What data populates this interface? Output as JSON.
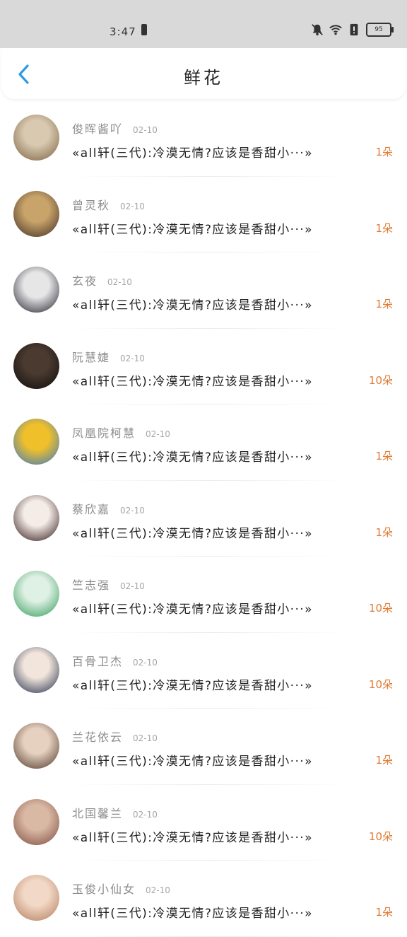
{
  "status": {
    "time": "3:47",
    "battery": "95"
  },
  "header": {
    "title": "鲜花"
  },
  "items": [
    {
      "name": "俊晖酱吖",
      "date": "02-10",
      "message": "«all轩(三代):冷漠无情?应该是香甜小···»",
      "count": "1朵",
      "avatar": [
        "#d8c9b0",
        "#7a5f3e"
      ]
    },
    {
      "name": "曾灵秋",
      "date": "02-10",
      "message": "«all轩(三代):冷漠无情?应该是香甜小···»",
      "count": "1朵",
      "avatar": [
        "#c9a46a",
        "#3d2b22"
      ]
    },
    {
      "name": "玄夜",
      "date": "02-10",
      "message": "«all轩(三代):冷漠无情?应该是香甜小···»",
      "count": "1朵",
      "avatar": [
        "#e6e6e6",
        "#1d1d2a"
      ]
    },
    {
      "name": "阮慧婕",
      "date": "02-10",
      "message": "«all轩(三代):冷漠无情?应该是香甜小···»",
      "count": "10朵",
      "avatar": [
        "#4a3a30",
        "#0e0b0a"
      ]
    },
    {
      "name": "凤凰院柯慧",
      "date": "02-10",
      "message": "«all轩(三代):冷漠无情?应该是香甜小···»",
      "count": "1朵",
      "avatar": [
        "#f0c02a",
        "#3577c7"
      ]
    },
    {
      "name": "蔡欣嘉",
      "date": "02-10",
      "message": "«all轩(三代):冷漠无情?应该是香甜小···»",
      "count": "1朵",
      "avatar": [
        "#f4ece6",
        "#2a1014"
      ]
    },
    {
      "name": "竺志强",
      "date": "02-10",
      "message": "«all轩(三代):冷漠无情?应该是香甜小···»",
      "count": "10朵",
      "avatar": [
        "#dff0e4",
        "#2e9a56"
      ]
    },
    {
      "name": "百骨卫杰",
      "date": "02-10",
      "message": "«all轩(三代):冷漠无情?应该是香甜小···»",
      "count": "10朵",
      "avatar": [
        "#f2e5dc",
        "#1e2a48"
      ]
    },
    {
      "name": "兰花依云",
      "date": "02-10",
      "message": "«all轩(三代):冷漠无情?应该是香甜小···»",
      "count": "1朵",
      "avatar": [
        "#e6d0c0",
        "#4a3324"
      ]
    },
    {
      "name": "北国馨兰",
      "date": "02-10",
      "message": "«all轩(三代):冷漠无情?应该是香甜小···»",
      "count": "10朵",
      "avatar": [
        "#d9b8a4",
        "#7d4a3c"
      ]
    },
    {
      "name": "玉俊小仙女",
      "date": "02-10",
      "message": "«all轩(三代):冷漠无情?应该是香甜小···»",
      "count": "1朵",
      "avatar": [
        "#f2d8c6",
        "#b07a5a"
      ]
    }
  ],
  "colors": {
    "accent": "#2b9be6",
    "count": "#e07a32"
  }
}
